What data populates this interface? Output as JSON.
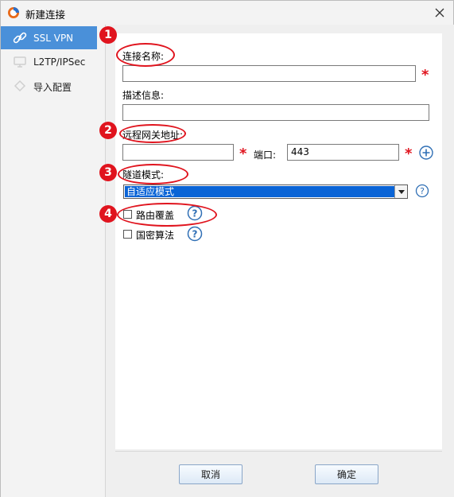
{
  "window": {
    "title": "新建连接",
    "close_glyph": "✕",
    "app_icon": "app-logo-icon"
  },
  "sidebar": {
    "items": [
      {
        "label": "SSL VPN",
        "icon": "link-icon",
        "active": true
      },
      {
        "label": "L2TP/IPSec",
        "icon": "network-icon",
        "active": false
      },
      {
        "label": "导入配置",
        "icon": "import-icon",
        "active": false
      }
    ]
  },
  "form": {
    "name_label": "连接名称:",
    "name_value": "",
    "desc_label": "描述信息:",
    "desc_value": "",
    "gateway_label": "远程网关地址:",
    "gateway_value": "",
    "port_label": "端口:",
    "port_value": "443",
    "tunnel_label": "隧道模式:",
    "tunnel_value": "自适应模式",
    "route_label": "路由覆盖",
    "route_checked": false,
    "crypto_label": "国密算法",
    "crypto_checked": false,
    "required_mark": "*",
    "help_glyph": "?"
  },
  "footer": {
    "cancel_label": "取消",
    "ok_label": "确定"
  },
  "annotations": [
    "1",
    "2",
    "3",
    "4"
  ],
  "colors": {
    "accent": "#4a90d9",
    "select_highlight": "#0a64d6",
    "required": "#e0141e",
    "annotation": "#e0141e",
    "help": "#2f6fb5"
  }
}
